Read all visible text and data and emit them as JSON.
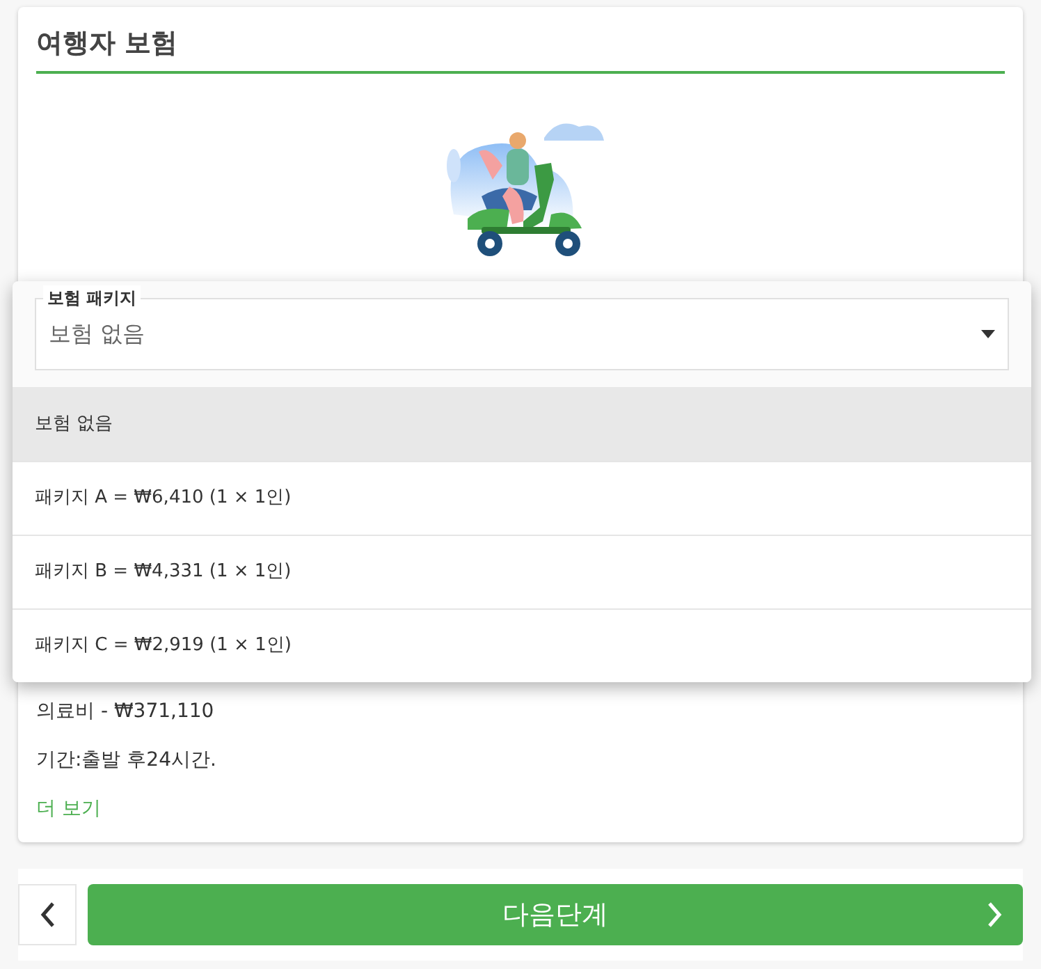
{
  "card": {
    "title": "여행자 보험",
    "details": [
      "의료비 - ₩371,110",
      "기간:출발 후24시간."
    ],
    "more_link": "더 보기"
  },
  "package_select": {
    "label": "보험 패키지",
    "value": "보험 없음",
    "options": [
      {
        "label": "보험 없음",
        "selected": true
      },
      {
        "label": "패키지 A = ₩6,410 (1 × 1인)",
        "selected": false
      },
      {
        "label": "패키지 B = ₩4,331 (1 × 1인)",
        "selected": false
      },
      {
        "label": "패키지 C = ₩2,919 (1 × 1인)",
        "selected": false
      }
    ]
  },
  "footer": {
    "next_button": "다음단계"
  }
}
